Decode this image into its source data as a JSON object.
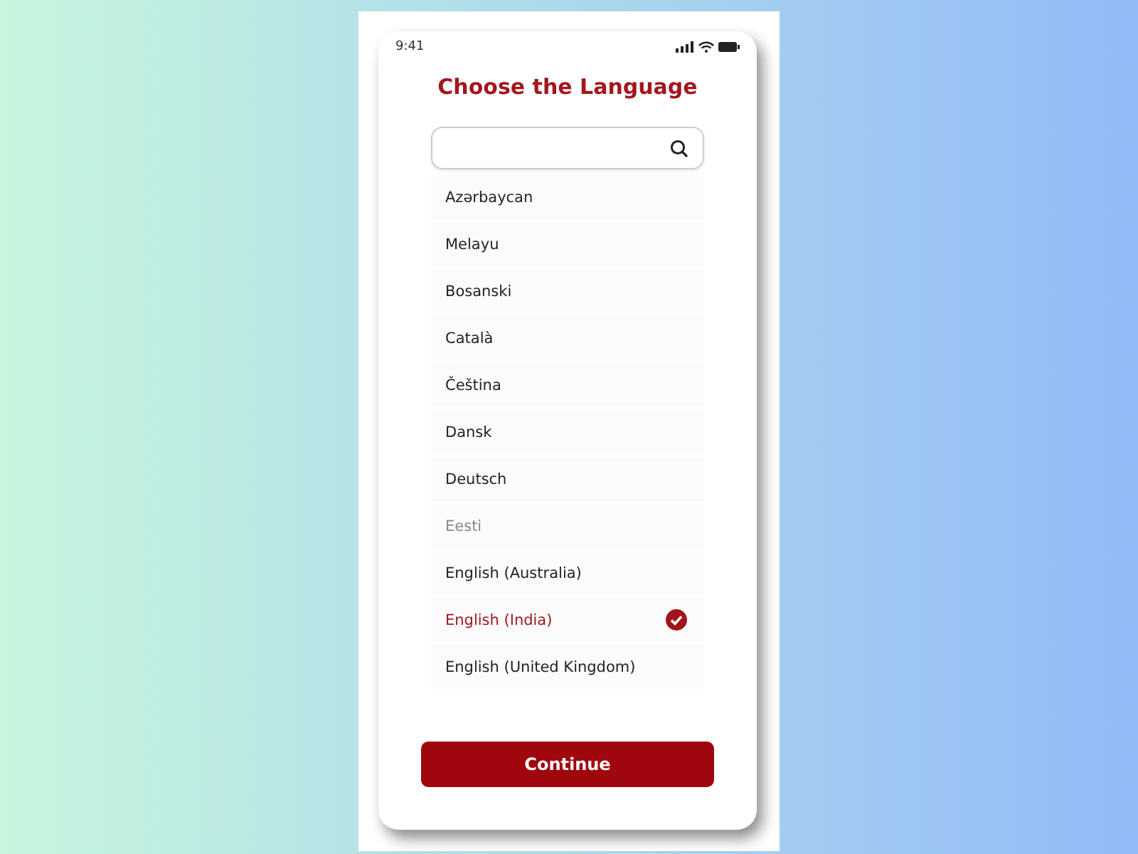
{
  "status_bar": {
    "time": "9:41"
  },
  "title": "Choose the Language",
  "languages": [
    {
      "label": "Azərbaycan",
      "selected": false,
      "disabled": false
    },
    {
      "label": "Melayu",
      "selected": false,
      "disabled": false
    },
    {
      "label": "Bosanski",
      "selected": false,
      "disabled": false
    },
    {
      "label": "Català",
      "selected": false,
      "disabled": false
    },
    {
      "label": "Čeština",
      "selected": false,
      "disabled": false
    },
    {
      "label": "Dansk",
      "selected": false,
      "disabled": false
    },
    {
      "label": "Deutsch",
      "selected": false,
      "disabled": false
    },
    {
      "label": "Eesti",
      "selected": false,
      "disabled": true
    },
    {
      "label": "English (Australia)",
      "selected": false,
      "disabled": false
    },
    {
      "label": "English (India)",
      "selected": true,
      "disabled": false
    },
    {
      "label": "English (United Kingdom)",
      "selected": false,
      "disabled": false
    }
  ],
  "continue_button": "Continue"
}
